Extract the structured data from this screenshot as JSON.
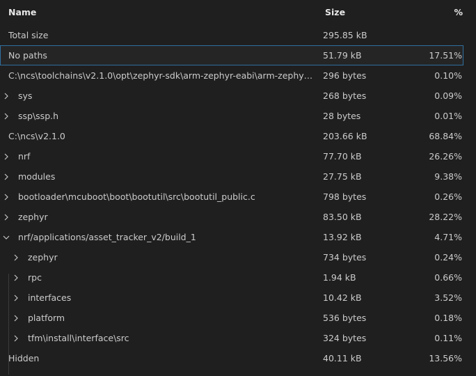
{
  "header": {
    "name": "Name",
    "size": "Size",
    "percent": "%"
  },
  "rows": [
    {
      "name": "Total size",
      "size": "295.85 kB",
      "percent": "",
      "expander": "none"
    },
    {
      "name": "No paths",
      "size": "51.79 kB",
      "percent": "17.51%",
      "expander": "none",
      "selected": true
    },
    {
      "name": "C:\\ncs\\toolchains\\v2.1.0\\opt\\zephyr-sdk\\arm-zephyr-eabi\\arm-zephyr-e...",
      "size": "296 bytes",
      "percent": "0.10%",
      "expander": "none"
    },
    {
      "name": "sys",
      "size": "268 bytes",
      "percent": "0.09%",
      "expander": "chevron-right"
    },
    {
      "name": "ssp\\ssp.h",
      "size": "28 bytes",
      "percent": "0.01%",
      "expander": "chevron-right"
    },
    {
      "name": "C:\\ncs\\v2.1.0",
      "size": "203.66 kB",
      "percent": "68.84%",
      "expander": "none"
    },
    {
      "name": "nrf",
      "size": "77.70 kB",
      "percent": "26.26%",
      "expander": "chevron-right"
    },
    {
      "name": "modules",
      "size": "27.75 kB",
      "percent": "9.38%",
      "expander": "chevron-right"
    },
    {
      "name": "bootloader\\mcuboot\\boot\\bootutil\\src\\bootutil_public.c",
      "size": "798 bytes",
      "percent": "0.26%",
      "expander": "chevron-right"
    },
    {
      "name": "zephyr",
      "size": "83.50 kB",
      "percent": "28.22%",
      "expander": "chevron-right"
    },
    {
      "name": "nrf/applications/asset_tracker_v2/build_1",
      "size": "13.92 kB",
      "percent": "4.71%",
      "expander": "chevron-down"
    },
    {
      "name": "zephyr",
      "size": "734 bytes",
      "percent": "0.24%",
      "expander": "chevron-right"
    },
    {
      "name": "rpc",
      "size": "1.94 kB",
      "percent": "0.66%",
      "expander": "chevron-right"
    },
    {
      "name": "interfaces",
      "size": "10.42 kB",
      "percent": "3.52%",
      "expander": "chevron-right"
    },
    {
      "name": "platform",
      "size": "536 bytes",
      "percent": "0.18%",
      "expander": "chevron-right"
    },
    {
      "name": "tfm\\install\\interface\\src",
      "size": "324 bytes",
      "percent": "0.11%",
      "expander": "chevron-right"
    },
    {
      "name": "Hidden",
      "size": "40.11 kB",
      "percent": "13.56%",
      "expander": "none"
    }
  ]
}
